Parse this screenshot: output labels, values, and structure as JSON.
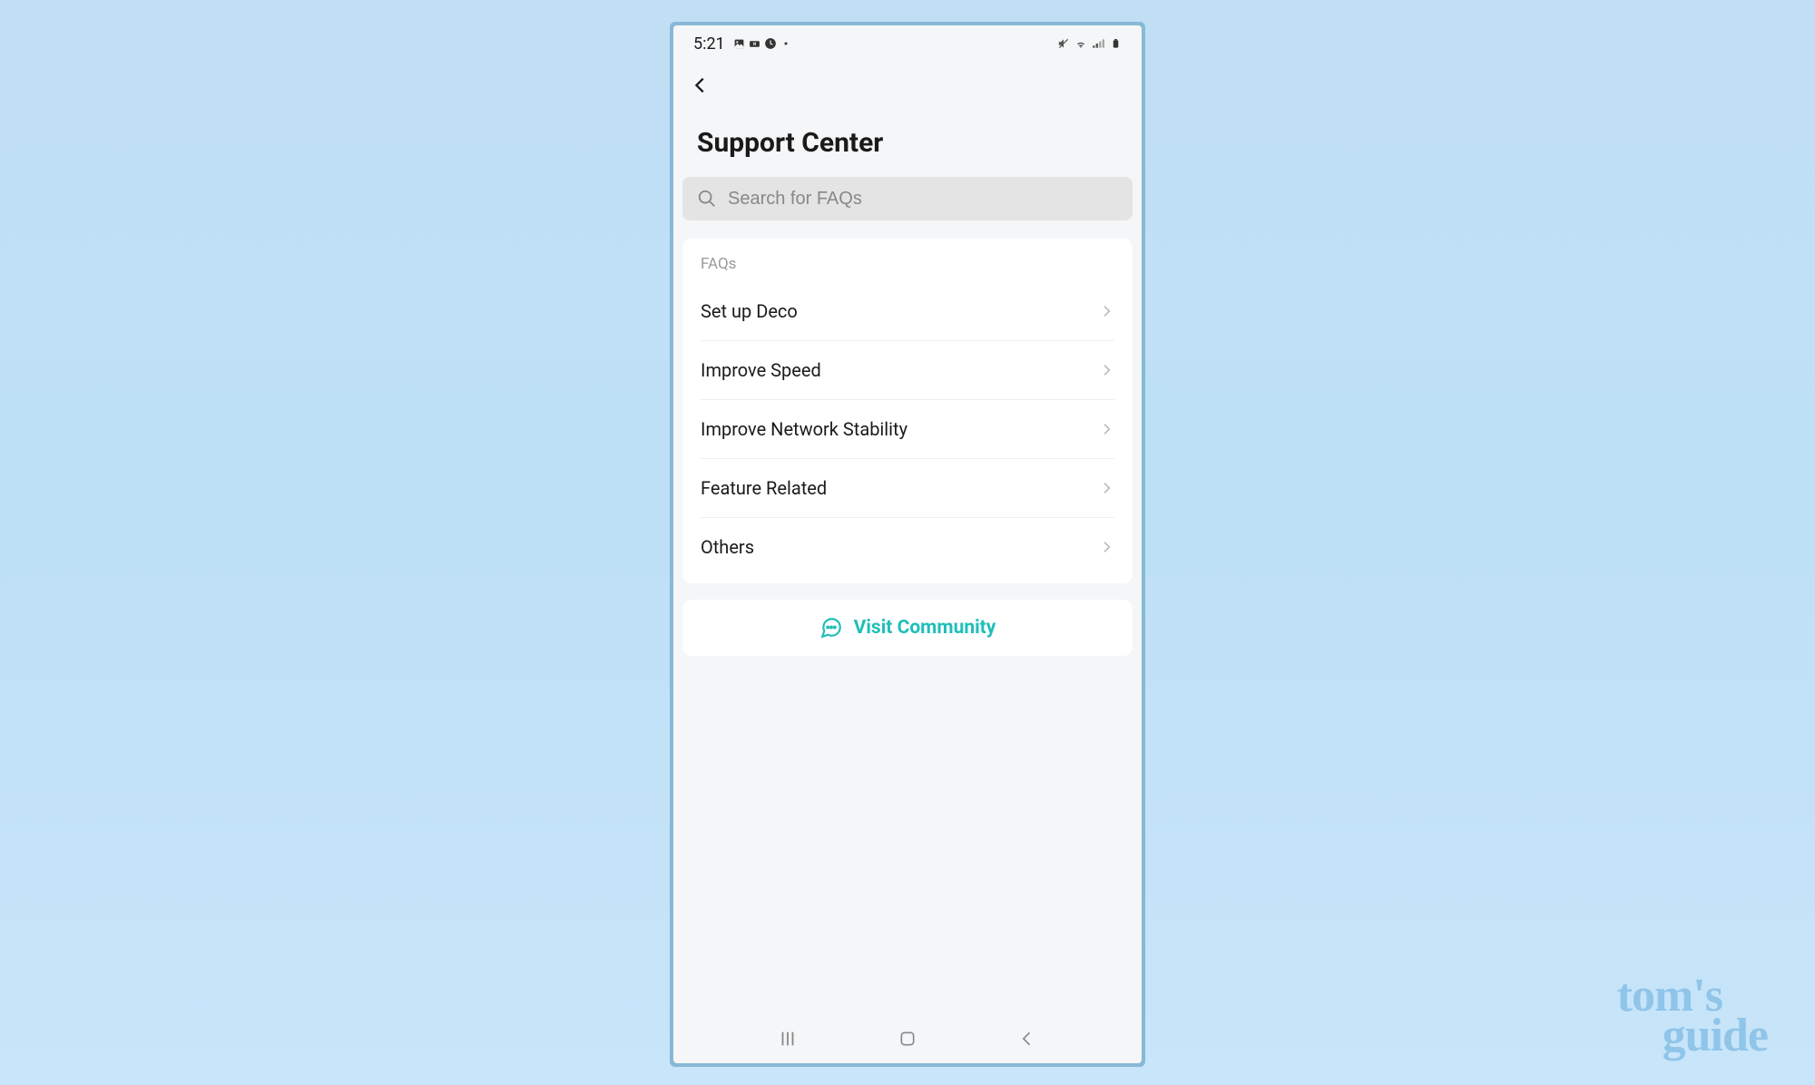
{
  "status": {
    "time": "5:21"
  },
  "header": {
    "title": "Support Center"
  },
  "search": {
    "placeholder": "Search for FAQs"
  },
  "faqs": {
    "label": "FAQs",
    "items": [
      {
        "label": "Set up Deco"
      },
      {
        "label": "Improve Speed"
      },
      {
        "label": "Improve Network Stability"
      },
      {
        "label": "Feature Related"
      },
      {
        "label": "Others"
      }
    ]
  },
  "community": {
    "label": "Visit Community"
  },
  "watermark": {
    "line1": "tom's",
    "line2": "guide"
  }
}
